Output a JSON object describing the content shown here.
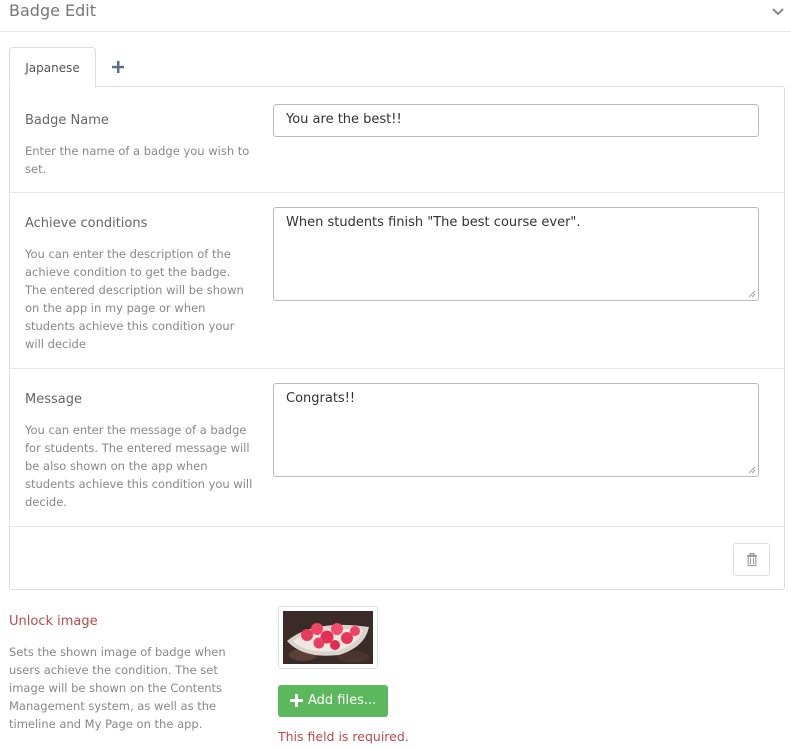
{
  "header": {
    "title": "Badge Edit",
    "chevron_icon": "chevron-down-icon"
  },
  "tabs": {
    "active_label": "Japanese",
    "add_icon": "plus-icon"
  },
  "fields": {
    "badge_name": {
      "label": "Badge Name",
      "help": "Enter the name of a badge you wish to set.",
      "value": "You are the best!!"
    },
    "achieve_conditions": {
      "label": "Achieve conditions",
      "help": "You can enter the description of the achieve condition to get the badge. The entered description will be shown on the app in my page or when students achieve this condition your will decide",
      "value": "When students finish \"The best course ever\"."
    },
    "message": {
      "label": "Message",
      "help": "You can enter the message of a badge for students. The entered message will be also shown on the app when students achieve this condition you will decide.",
      "value": "Congrats!!"
    }
  },
  "delete_icon": "trash-icon",
  "unlock_image": {
    "label": "Unlock image",
    "help": "Sets the shown image of badge when users achieve the condition. The set image will be shown on the Contents Management system, as well as the timeline and My Page on the app.",
    "add_files_label": "Add files...",
    "error": "This field is required."
  },
  "colors": {
    "error": "#b94a48",
    "success": "#5cb85c"
  }
}
